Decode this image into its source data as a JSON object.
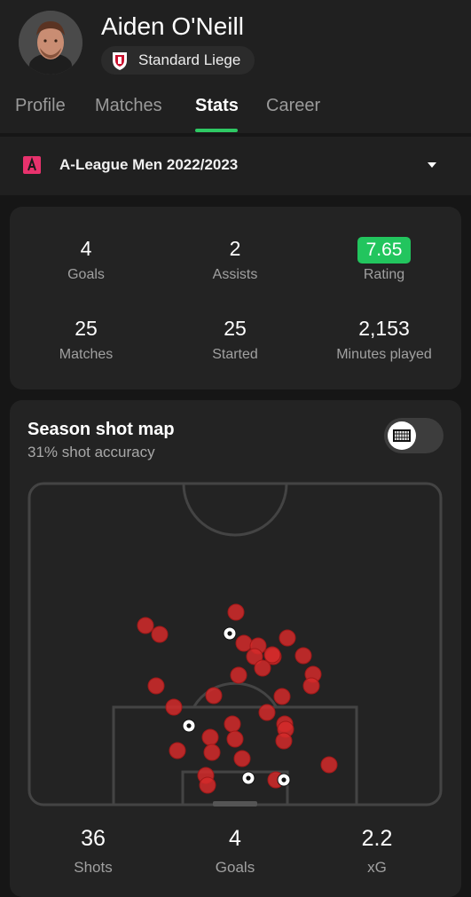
{
  "player": {
    "name": "Aiden O'Neill",
    "team": "Standard Liege"
  },
  "tabs": [
    {
      "label": "Profile",
      "active": false
    },
    {
      "label": "Matches",
      "active": false
    },
    {
      "label": "Stats",
      "active": true
    },
    {
      "label": "Career",
      "active": false
    }
  ],
  "league": {
    "name": "A-League Men 2022/2023"
  },
  "season_stats": {
    "goals": {
      "value": "4",
      "label": "Goals"
    },
    "assists": {
      "value": "2",
      "label": "Assists"
    },
    "rating": {
      "value": "7.65",
      "label": "Rating"
    },
    "matches": {
      "value": "25",
      "label": "Matches"
    },
    "started": {
      "value": "25",
      "label": "Started"
    },
    "minutes": {
      "value": "2,153",
      "label": "Minutes played"
    }
  },
  "shot_map": {
    "title": "Season shot map",
    "subtitle": "31% shot accuracy",
    "toggle_on": false
  },
  "shot_totals": {
    "shots": {
      "value": "36",
      "label": "Shots"
    },
    "goals": {
      "value": "4",
      "label": "Goals"
    },
    "xg": {
      "value": "2.2",
      "label": "xG"
    }
  },
  "colors": {
    "accent": "#2ec964",
    "rating": "#22c55e",
    "shot": "#d42a2a"
  }
}
